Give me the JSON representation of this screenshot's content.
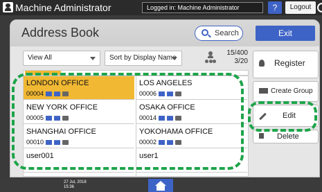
{
  "topbar": {
    "admin_name": "Machine Administrator",
    "logged_in": "Logged in: Machine Administrator",
    "help_label": "?",
    "logout_label": "Logout"
  },
  "panel": {
    "title": "Address Book",
    "search_label": "Search",
    "exit_label": "Exit"
  },
  "toolbar": {
    "view_select": "View All",
    "sort_select": "Sort by Display Name",
    "count_main": "15/400",
    "count_page": "3/20"
  },
  "entries": [
    {
      "name": "LONDON OFFICE",
      "number": "00004",
      "selected": true
    },
    {
      "name": "LOS ANGELES",
      "number": "00006",
      "selected": false
    },
    {
      "name": "NEW YORK OFFICE",
      "number": "00005",
      "selected": false
    },
    {
      "name": "OSAKA OFFICE",
      "number": "00014",
      "selected": false
    },
    {
      "name": "SHANGHAI OFFICE",
      "number": "00010",
      "selected": false
    },
    {
      "name": "YOKOHAMA OFFICE",
      "number": "00002",
      "selected": false
    },
    {
      "name": "user001",
      "number": "",
      "selected": false
    },
    {
      "name": "user1",
      "number": "",
      "selected": false
    }
  ],
  "side": {
    "register_label": "Register",
    "create_group_label": "Create Group",
    "edit_label": "Edit",
    "delete_label": "Delete"
  },
  "bottombar": {
    "date": "27 Jul, 2018",
    "time": "15:36"
  },
  "colors": {
    "accent": "#3e63c6",
    "selected": "#f1b833",
    "highlight": "#1ea44a"
  }
}
